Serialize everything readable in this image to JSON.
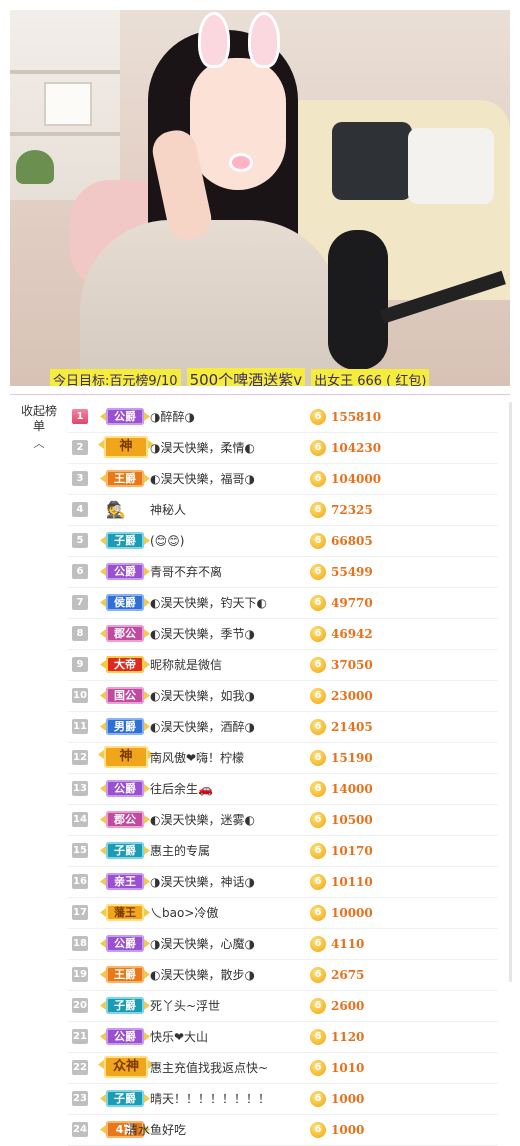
{
  "ticker": [
    {
      "text": "今日目标:百元榜9/10",
      "highlight": true
    },
    {
      "text": "500个啤酒送紫v",
      "highlight": true
    },
    {
      "text": "出女王 666 ( 红包)",
      "highlight": true
    }
  ],
  "side": {
    "label": "收起榜单",
    "chevron": "︿"
  },
  "coin_glyph": "6",
  "ranking": [
    {
      "rank": "1",
      "badge": "公爵",
      "style": "b-purple",
      "name": "◑醉醉◑",
      "score": "155810"
    },
    {
      "rank": "2",
      "badge": "神",
      "style": "b-gold wide",
      "name": "◑淏天快樂，柔情◐",
      "score": "104230"
    },
    {
      "rank": "3",
      "badge": "王爵",
      "style": "b-orange",
      "name": "◐淏天快樂，福哥◑",
      "score": "104000"
    },
    {
      "rank": "4",
      "badge": "🕵",
      "style": "b-mystery",
      "name": "神秘人",
      "score": "72325"
    },
    {
      "rank": "5",
      "badge": "子爵",
      "style": "b-teal",
      "name": "(😊😊)",
      "score": "66805"
    },
    {
      "rank": "6",
      "badge": "公爵",
      "style": "b-purple",
      "name": "青哥不弃不离",
      "score": "55499"
    },
    {
      "rank": "7",
      "badge": "侯爵",
      "style": "b-blue",
      "name": "◐淏天快樂，钓天下◐",
      "score": "49770"
    },
    {
      "rank": "8",
      "badge": "郡公",
      "style": "b-rose",
      "name": "◐淏天快樂，季节◑",
      "score": "46942"
    },
    {
      "rank": "9",
      "badge": "大帝",
      "style": "b-red",
      "name": "昵称就是微信",
      "score": "37050"
    },
    {
      "rank": "10",
      "badge": "国公",
      "style": "b-rose",
      "name": "◐淏天快樂，如我◑",
      "score": "23000"
    },
    {
      "rank": "11",
      "badge": "男爵",
      "style": "b-blue",
      "name": "◐淏天快樂，酒醉◑",
      "score": "21405"
    },
    {
      "rank": "12",
      "badge": "神",
      "style": "b-gold wide",
      "name": "南风傲❤嗨！柠檬",
      "score": "15190"
    },
    {
      "rank": "13",
      "badge": "公爵",
      "style": "b-purple",
      "name": "往后余生🚗",
      "score": "14000"
    },
    {
      "rank": "14",
      "badge": "郡公",
      "style": "b-rose",
      "name": "◐淏天快樂，迷雾◐",
      "score": "10500"
    },
    {
      "rank": "15",
      "badge": "子爵",
      "style": "b-teal",
      "name": "惠主的专属",
      "score": "10170"
    },
    {
      "rank": "16",
      "badge": "亲王",
      "style": "b-purple",
      "name": "◑淏天快樂，神话◑",
      "score": "10110"
    },
    {
      "rank": "17",
      "badge": "藩王",
      "style": "b-gold",
      "name": "乀bao>冷傲",
      "score": "10000"
    },
    {
      "rank": "18",
      "badge": "公爵",
      "style": "b-purple",
      "name": "◑淏天快樂，心魔◑",
      "score": "4110"
    },
    {
      "rank": "19",
      "badge": "王爵",
      "style": "b-orange",
      "name": "◐淏天快樂，散步◑",
      "score": "2675"
    },
    {
      "rank": "20",
      "badge": "子爵",
      "style": "b-teal",
      "name": "死丫头~浮世",
      "score": "2600"
    },
    {
      "rank": "21",
      "badge": "公爵",
      "style": "b-purple",
      "name": "快乐❤大山",
      "score": "1120"
    },
    {
      "rank": "22",
      "badge": "众神",
      "style": "b-gold wide",
      "name": "惠主充值找我返点快~",
      "score": "1010"
    },
    {
      "rank": "23",
      "badge": "子爵",
      "style": "b-teal",
      "name": "晴天！！！！！！！！",
      "score": "1000"
    },
    {
      "rank": "24",
      "badge": "4富",
      "style": "b-orange",
      "name": "清水鱼好吃",
      "score": "1000",
      "shift": true
    }
  ]
}
